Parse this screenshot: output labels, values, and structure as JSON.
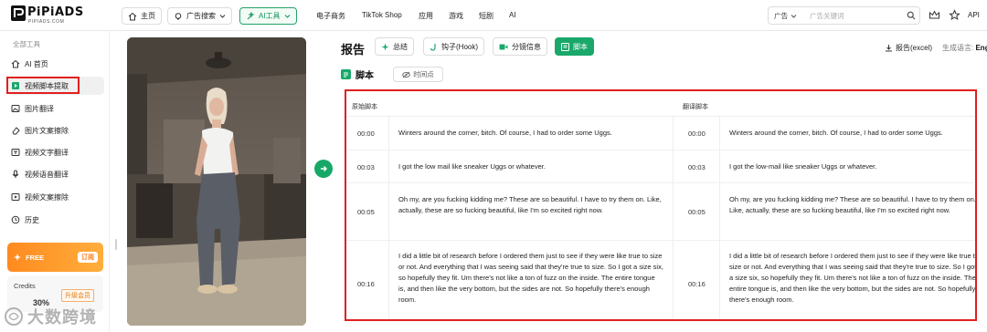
{
  "header": {
    "logo_title": "PiPiADS",
    "logo_sub": "PIPIADS.COM",
    "home_label": "主页",
    "ad_search_label": "广告搜索",
    "ai_tools_label": "AI工具",
    "nav": [
      "电子商务",
      "TikTok Shop",
      "应用",
      "游戏",
      "短剧",
      "AI"
    ],
    "search_type": "广告",
    "search_placeholder": "广告关键词",
    "api_label": "API"
  },
  "sidebar": {
    "section_label": "全部工具",
    "items": [
      {
        "label": "AI 首页",
        "icon": "home-icon"
      },
      {
        "label": "视频脚本提取",
        "icon": "script-icon",
        "active": true
      },
      {
        "label": "图片翻译",
        "icon": "image-icon"
      },
      {
        "label": "图片文案擦除",
        "icon": "eraser-icon"
      },
      {
        "label": "视频文字翻译",
        "icon": "video-text-icon"
      },
      {
        "label": "视频语音翻译",
        "icon": "microphone-icon"
      },
      {
        "label": "视频文案擦除",
        "icon": "video-erase-icon"
      },
      {
        "label": "历史",
        "icon": "history-icon"
      }
    ],
    "free_label": "FREE",
    "subscribe_label": "订阅",
    "credits_label": "Credits",
    "upgrade_label": "升级会员",
    "credits_percent": "30%",
    "watermark": "大数跨境"
  },
  "report": {
    "title": "报告",
    "tabs": [
      "总结",
      "钩子(Hook)",
      "分镜信息",
      "脚本"
    ],
    "active_tab": "脚本",
    "export_label": "报告(excel)",
    "lang_label": "生成语言:",
    "lang_value": "Eng",
    "script_title": "脚本",
    "timestamp_btn": "时间点"
  },
  "table": {
    "col_original": "原始脚本",
    "col_translated": "翻译脚本",
    "rows": [
      {
        "time": "00:00",
        "original": "Winters around the corner, bitch. Of course, I had to order some Uggs.",
        "translated": "Winters around the corner, bitch. Of course, I had to order some Uggs."
      },
      {
        "time": "00:03",
        "original": "I got the low mail like sneaker Uggs or whatever.",
        "translated": "I got the low-mail like sneaker Uggs or whatever."
      },
      {
        "time": "00:05",
        "original": "Oh my, are you fucking kidding me? These are so beautiful. I have to try them on. Like, actually, these are so fucking beautiful, like I'm so excited right now.",
        "translated": "Oh my, are you fucking kidding me? These are so beautiful. I have to try them on. Like, actually, these are so fucking beautiful, like I'm so excited right now."
      },
      {
        "time": "00:16",
        "original": "I did a little bit of research before I ordered them just to see if they were like true to size or not. And everything that I was seeing said that they're true to size. So I got a size six, so hopefully they fit. Um there's not like a ton of fuzz on the inside. The entire tongue is, and then like the very bottom, but the sides are not. So hopefully there's enough room.",
        "translated": "I did a little bit of research before I ordered them just to see if they were like true to size or not. And everything that I was seeing said that they're true to size. So I got a size six, so hopefully they fit. Um there's not like a ton of fuzz on the inside. The entire tongue is, and then like the very bottom, but the sides are not. So hopefully there's enough room."
      }
    ]
  },
  "colors": {
    "brand_green": "#19a86a",
    "highlight_red": "#e02020",
    "free_orange": "#ff8a1f"
  }
}
